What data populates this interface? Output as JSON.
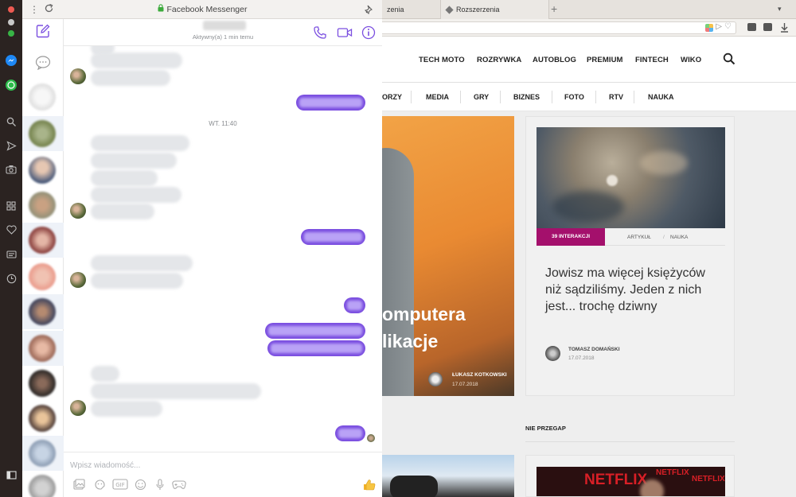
{
  "window": {
    "title": "Facebook Messenger"
  },
  "browser": {
    "tabs": [
      {
        "label": "zenia"
      },
      {
        "label": "Rozszerzenia"
      }
    ]
  },
  "site": {
    "nav": [
      "TECH MOTO",
      "ROZRYWKA",
      "AUTOBLOG",
      "PREMIUM",
      "FINTECH",
      "WIKO"
    ],
    "subnav": [
      "ORZY",
      "MEDIA",
      "GRY",
      "BIZNES",
      "FOTO",
      "RTV",
      "NAUKA"
    ],
    "hero": {
      "title_line1": "omputera",
      "title_line2": "likacje",
      "author": "ŁUKASZ KOTKOWSKI",
      "date": "17.07.2018"
    },
    "article": {
      "badge": "39 INTERAKCJI",
      "tag1": "ARTYKUŁ",
      "tag_sep": "/",
      "tag2": "NAUKA",
      "title": "Jowisz ma więcej księżyców niż sądziliśmy. Jeden z nich jest... trochę dziwny",
      "author": "TOMASZ DOMAŃSKI",
      "date": "17.07.2018"
    },
    "section_label": "NIE PRZEGAP",
    "netflix_text": "NETFLIX"
  },
  "chat": {
    "status": "Aktywny(a) 1 min temu",
    "time_separator": "WT. 11:40",
    "composer_placeholder": "Wpisz wiadomość..."
  },
  "colors": {
    "messenger_accent": "#7b4fe0",
    "badge": "#a4106c"
  },
  "icons": {
    "left_strip": [
      "messenger-icon",
      "whatsapp-icon",
      "search-icon",
      "send-icon",
      "camera-icon",
      "grid-icon",
      "heart-icon",
      "news-icon",
      "clock-icon",
      "sidebar-toggle-icon"
    ],
    "composer": [
      "image-icon",
      "sticker-icon",
      "gif-icon",
      "emoji-icon",
      "microphone-icon",
      "game-icon",
      "thumbs-up-icon"
    ]
  }
}
